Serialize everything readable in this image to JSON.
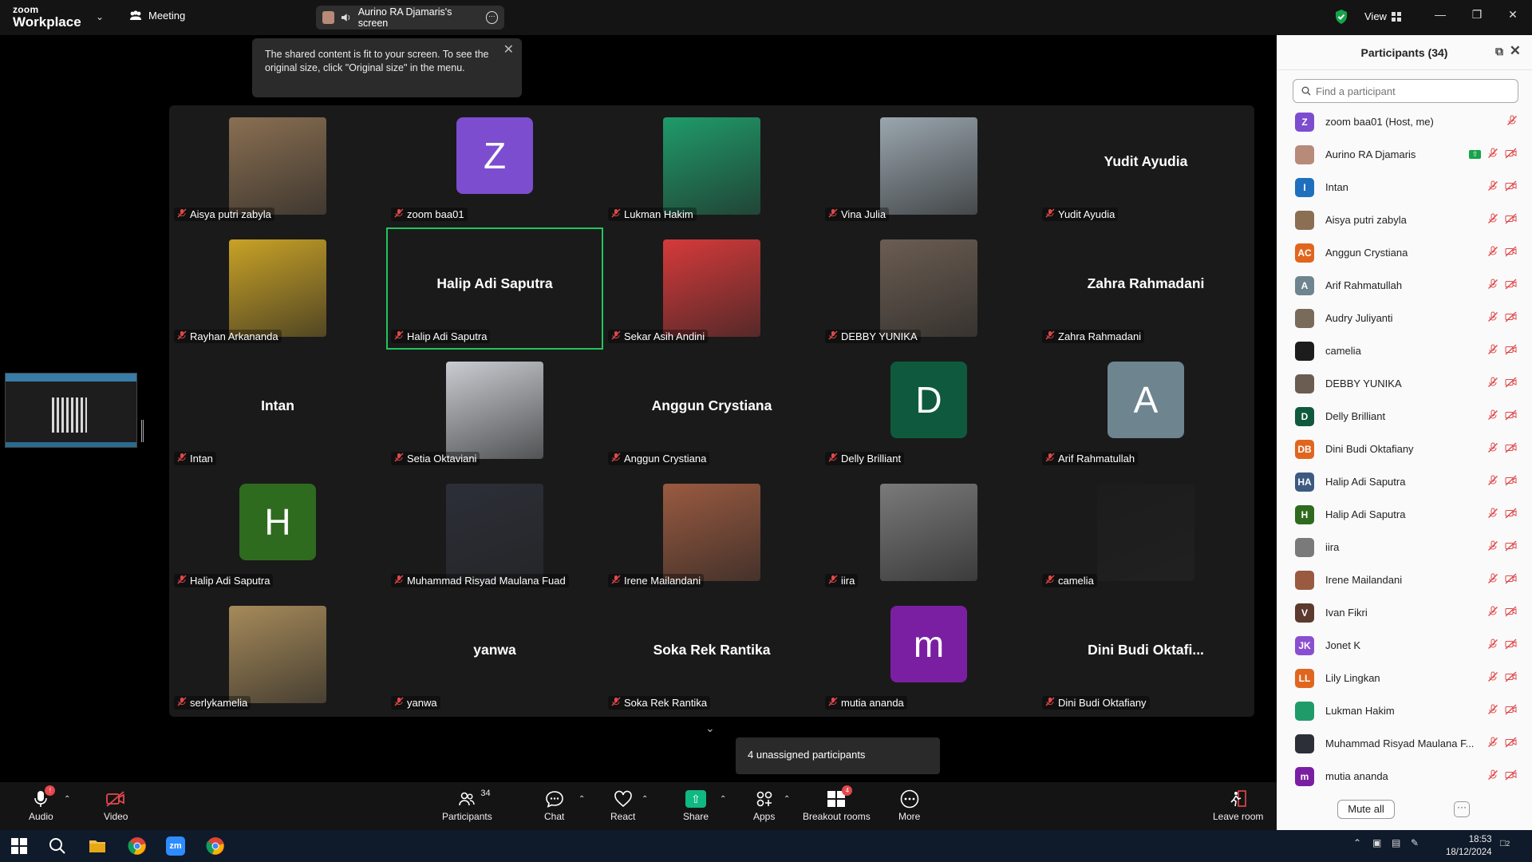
{
  "app": {
    "logo_line1": "zoom",
    "logo_line2": "Workplace",
    "meeting_label": "Meeting",
    "share_pill": "Aurino RA Djamaris's screen",
    "view_label": "View"
  },
  "tooltip": {
    "text": "The shared content is fit to your screen. To see the original size, click \"Original size\" in the menu."
  },
  "gallery": {
    "tiles": [
      {
        "label": "Aisya putri zabyla",
        "kind": "photo",
        "color": "#8a6f52"
      },
      {
        "label": "zoom baa01",
        "kind": "avatar",
        "initial": "Z",
        "color": "#7c4dce"
      },
      {
        "label": "Lukman Hakim",
        "kind": "photo",
        "color": "#1f9b6a"
      },
      {
        "label": "Vina Julia",
        "kind": "photo",
        "color": "#9aa6ae"
      },
      {
        "label": "Yudit Ayudia",
        "kind": "name",
        "display": "Yudit Ayudia"
      },
      {
        "label": "Rayhan Arkananda",
        "kind": "photo",
        "color": "#c9a227"
      },
      {
        "label": "Halip Adi Saputra",
        "kind": "name",
        "display": "Halip Adi Saputra",
        "active": true
      },
      {
        "label": "Sekar Asih Andini",
        "kind": "photo",
        "color": "#d63a3a"
      },
      {
        "label": "DEBBY YUNIKA",
        "kind": "photo",
        "color": "#6b5d52"
      },
      {
        "label": "Zahra Rahmadani",
        "kind": "name",
        "display": "Zahra Rahmadani"
      },
      {
        "label": "Intan",
        "kind": "name",
        "display": "Intan"
      },
      {
        "label": "Setia Oktaviani",
        "kind": "photo",
        "color": "#c9ccd1"
      },
      {
        "label": "Anggun Crystiana",
        "kind": "name",
        "display": "Anggun Crystiana"
      },
      {
        "label": "Delly Brilliant",
        "kind": "avatar",
        "initial": "D",
        "color": "#0f5a3e"
      },
      {
        "label": "Arif Rahmatullah",
        "kind": "avatar",
        "initial": "A",
        "color": "#6e8590"
      },
      {
        "label": "Halip Adi Saputra",
        "kind": "avatar",
        "initial": "H",
        "color": "#2e6b1f"
      },
      {
        "label": "Muhammad Risyad Maulana Fuad",
        "kind": "photo",
        "color": "#2c2f38"
      },
      {
        "label": "Irene Mailandani",
        "kind": "photo",
        "color": "#9a5a40"
      },
      {
        "label": "iira",
        "kind": "photo",
        "color": "#7a7a7a"
      },
      {
        "label": "camelia",
        "kind": "photo",
        "color": "#1c1c1c"
      },
      {
        "label": "serlykamelia",
        "kind": "photo",
        "color": "#a68a5a"
      },
      {
        "label": "yanwa",
        "kind": "name",
        "display": "yanwa"
      },
      {
        "label": "Soka Rek Rantika",
        "kind": "name",
        "display": "Soka Rek Rantika"
      },
      {
        "label": "mutia ananda",
        "kind": "avatar",
        "initial": "m",
        "color": "#7b1fa2"
      },
      {
        "label": "Dini Budi Oktafiany",
        "kind": "name",
        "display": "Dini Budi Oktafi..."
      }
    ],
    "unassigned": "4 unassigned participants"
  },
  "participants": {
    "title": "Participants (34)",
    "search_placeholder": "Find a participant",
    "mute_all": "Mute all",
    "list": [
      {
        "name": "zoom baa01 (Host, me)",
        "initial": "Z",
        "color": "#7c4dce",
        "self": true
      },
      {
        "name": "Aurino RA Djamaris",
        "initial": "",
        "color": "#b88a7a",
        "sharing": true
      },
      {
        "name": "Intan",
        "initial": "I",
        "color": "#1f6fbf"
      },
      {
        "name": "Aisya putri zabyla",
        "initial": "",
        "color": "#8a6f52"
      },
      {
        "name": "Anggun Crystiana",
        "initial": "AC",
        "color": "#e0661f"
      },
      {
        "name": "Arif Rahmatullah",
        "initial": "A",
        "color": "#6e8590"
      },
      {
        "name": "Audry Juliyanti",
        "initial": "",
        "color": "#7a6a5a"
      },
      {
        "name": "camelia",
        "initial": "",
        "color": "#1c1c1c"
      },
      {
        "name": "DEBBY YUNIKA",
        "initial": "",
        "color": "#6b5d52"
      },
      {
        "name": "Delly Brilliant",
        "initial": "D",
        "color": "#0f5a3e"
      },
      {
        "name": "Dini Budi Oktafiany",
        "initial": "DB",
        "color": "#e0661f"
      },
      {
        "name": "Halip Adi Saputra",
        "initial": "HA",
        "color": "#3d5a80"
      },
      {
        "name": "Halip Adi Saputra",
        "initial": "H",
        "color": "#2e6b1f"
      },
      {
        "name": "iira",
        "initial": "",
        "color": "#7a7a7a"
      },
      {
        "name": "Irene Mailandani",
        "initial": "",
        "color": "#9a5a40"
      },
      {
        "name": "Ivan Fikri",
        "initial": "V",
        "color": "#5d3a2e"
      },
      {
        "name": "Jonet K",
        "initial": "JK",
        "color": "#8a4fd0"
      },
      {
        "name": "Lily Lingkan",
        "initial": "LL",
        "color": "#e0661f"
      },
      {
        "name": "Lukman Hakim",
        "initial": "",
        "color": "#1f9b6a"
      },
      {
        "name": "Muhammad Risyad Maulana F...",
        "initial": "",
        "color": "#2c2f38"
      },
      {
        "name": "mutia ananda",
        "initial": "m",
        "color": "#7b1fa2"
      }
    ]
  },
  "toolbar": {
    "audio": "Audio",
    "video": "Video",
    "participants": "Participants",
    "participants_count": "34",
    "chat": "Chat",
    "react": "React",
    "share": "Share",
    "apps": "Apps",
    "breakout": "Breakout rooms",
    "breakout_badge": "4",
    "more": "More",
    "leave": "Leave room",
    "audio_badge": "!"
  },
  "taskbar": {
    "time": "18:53",
    "date": "18/12/2024",
    "notif_count": "2",
    "zoom_icon_text": "zm"
  }
}
